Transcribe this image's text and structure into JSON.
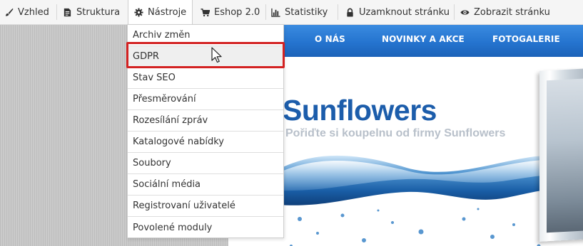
{
  "toolbar": {
    "items": [
      {
        "label": "Vzhled",
        "icon": "brush-icon"
      },
      {
        "label": "Struktura",
        "icon": "document-icon"
      },
      {
        "label": "Nástroje",
        "icon": "gear-icon"
      },
      {
        "label": "Eshop 2.0",
        "icon": "cart-icon"
      },
      {
        "label": "Statistiky",
        "icon": "bar-chart-icon"
      },
      {
        "label": "Uzamknout stránku",
        "icon": "lock-icon"
      },
      {
        "label": "Zobrazit stránku",
        "icon": "eye-icon"
      }
    ],
    "active": "Nástroje"
  },
  "dropdown": {
    "items": [
      {
        "label": "Archiv změn"
      },
      {
        "label": "GDPR",
        "highlighted": true
      },
      {
        "label": "Stav SEO"
      },
      {
        "label": "Přesměrování"
      },
      {
        "label": "Rozesílání zpráv"
      },
      {
        "label": "Katalogové nabídky"
      },
      {
        "label": "Soubory"
      },
      {
        "label": "Sociální média"
      },
      {
        "label": "Registrovaní uživatelé"
      },
      {
        "label": "Povolené moduly"
      }
    ],
    "highlight_color": "#d32222"
  },
  "site": {
    "nav": [
      "O NÁS",
      "NOVINKY A AKCE",
      "FOTOGALERIE"
    ],
    "title": "Sunflowers",
    "subtitle": "Pořiďte si koupelnu od firmy Sunflowers",
    "nav_color": "#2574cf",
    "title_color": "#1c5dab"
  }
}
